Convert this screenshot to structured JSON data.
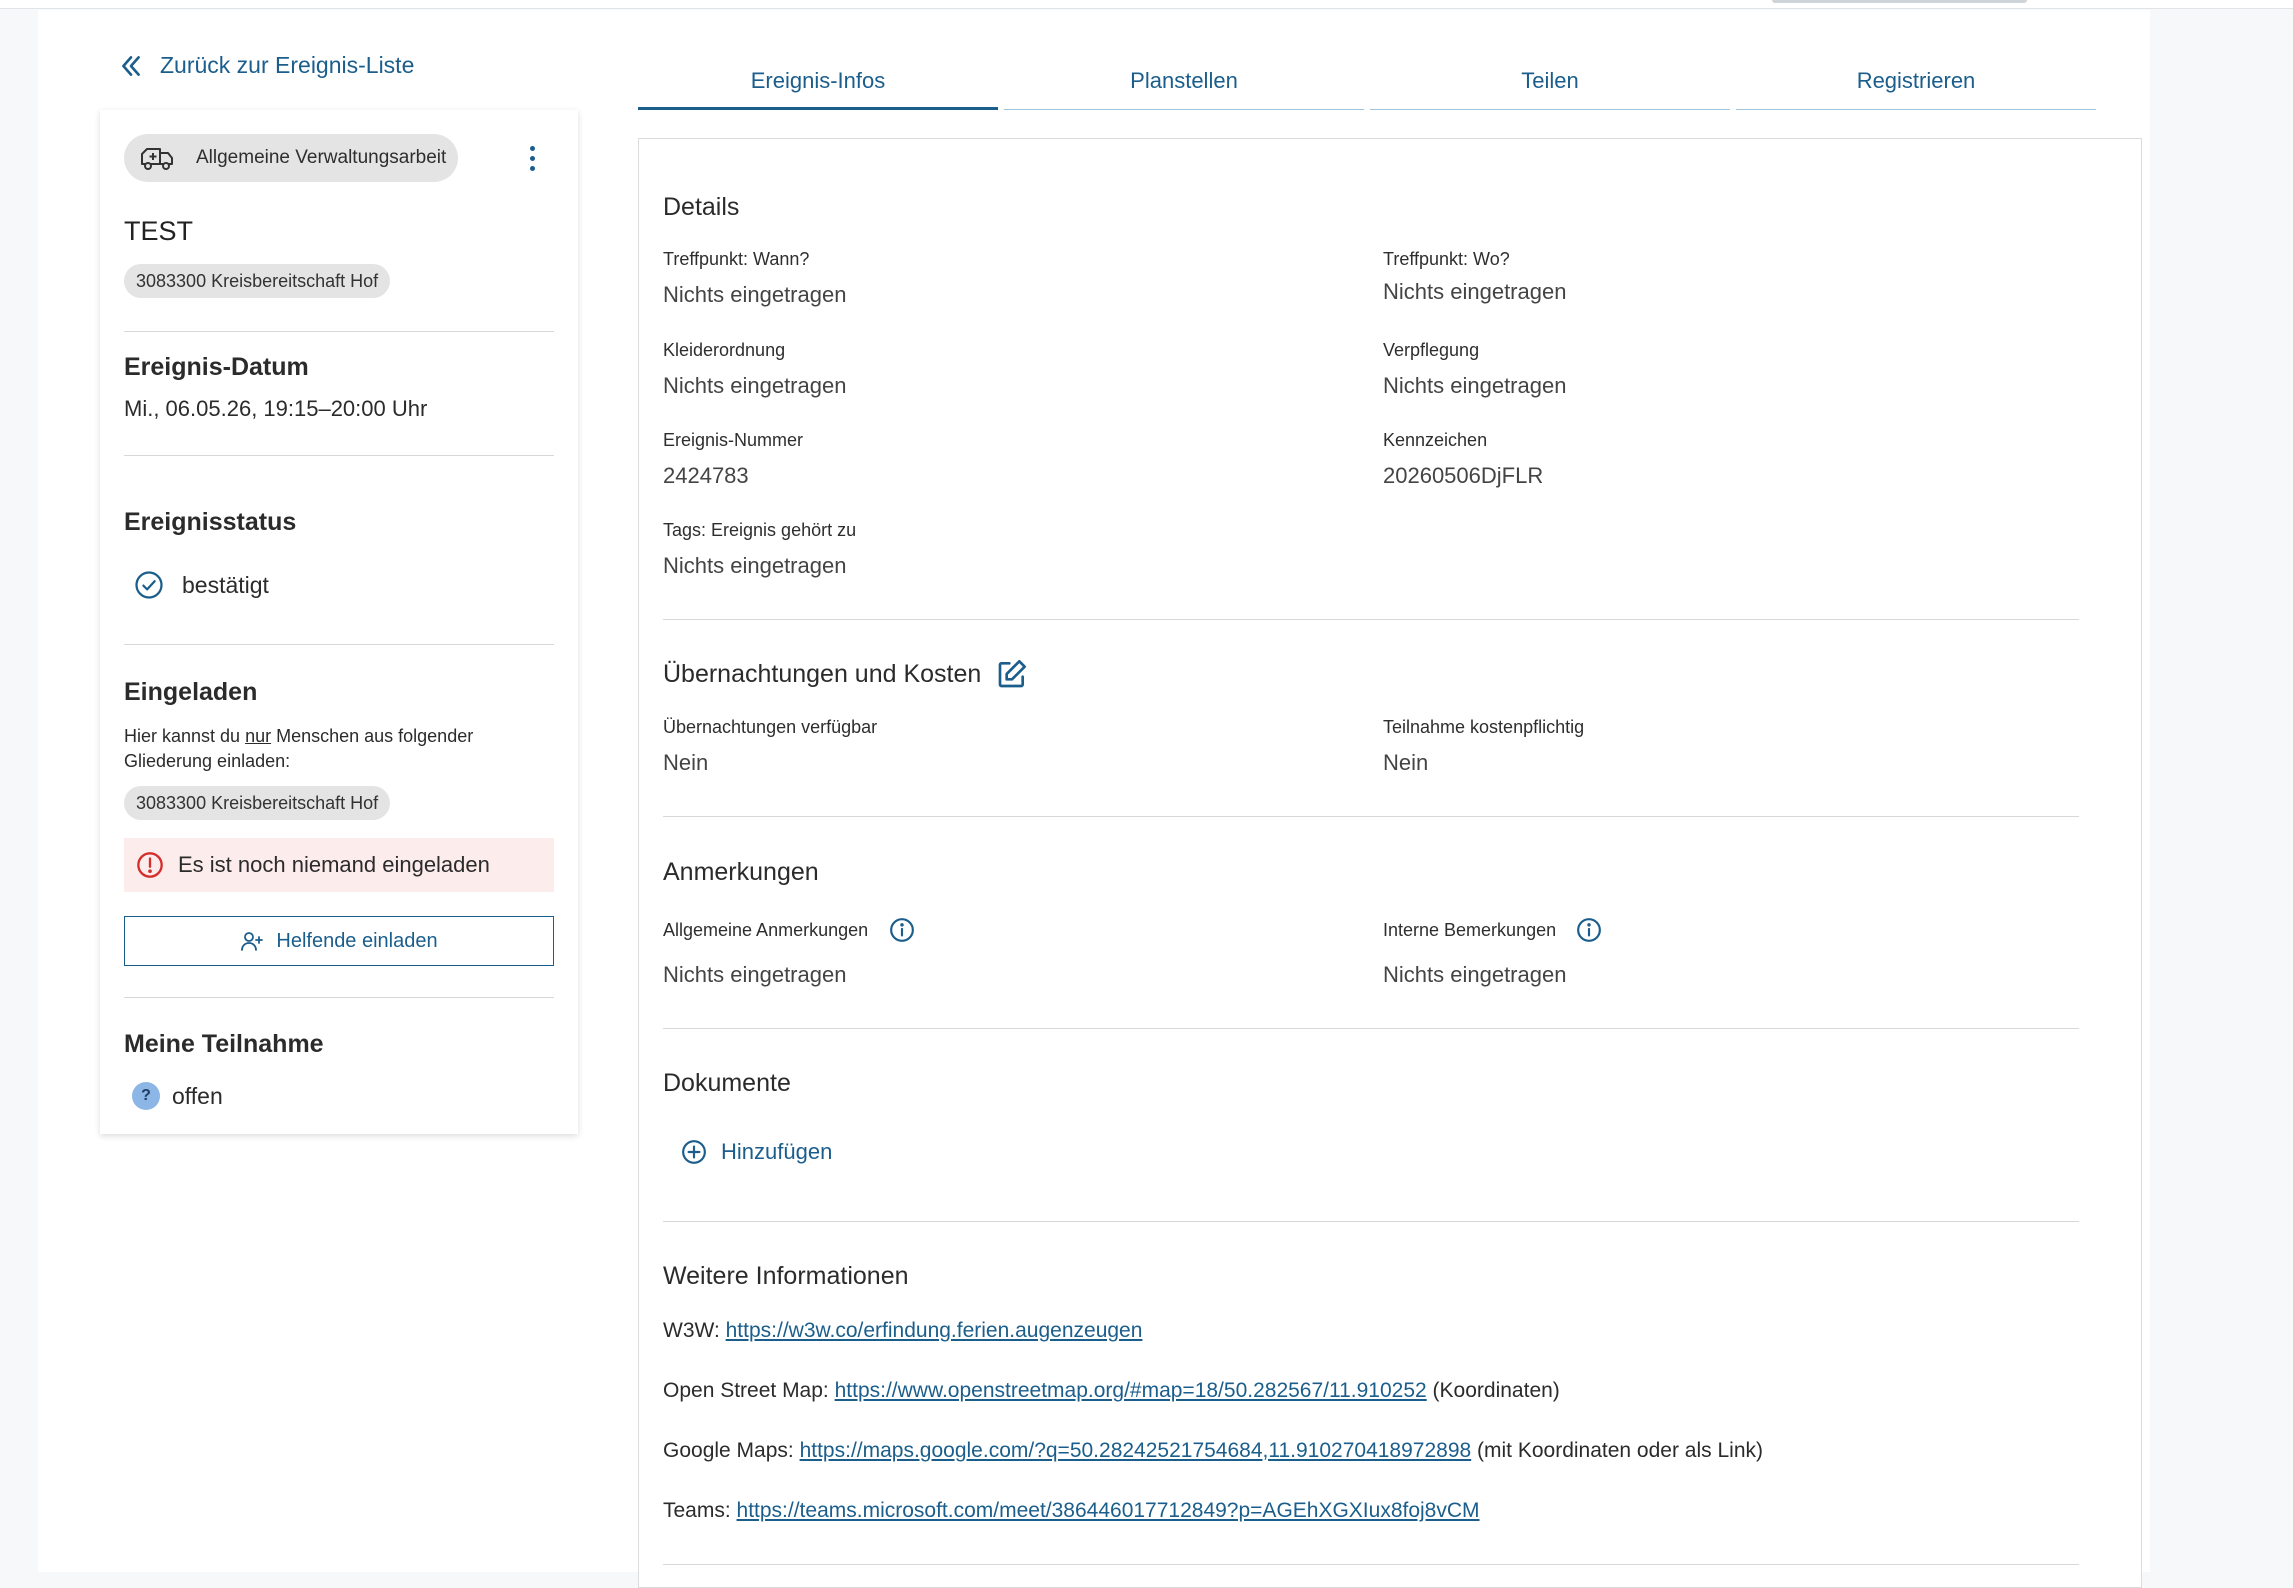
{
  "back_link": {
    "label": "Zurück zur Ereignis-Liste"
  },
  "tabs": [
    {
      "label": "Ereignis-Infos",
      "active": true
    },
    {
      "label": "Planstellen",
      "active": false
    },
    {
      "label": "Teilen",
      "active": false
    },
    {
      "label": "Registrieren",
      "active": false
    }
  ],
  "sidebar": {
    "type_chip": "Allgemeine Verwaltungsarbeit",
    "title": "TEST",
    "org": "3083300 Kreisbereitschaft Hof",
    "date_heading": "Ereignis-Datum",
    "date_value": "Mi., 06.05.26, 19:15–20:00 Uhr",
    "status_heading": "Ereignisstatus",
    "status_value": "bestätigt",
    "invited_heading": "Eingeladen",
    "invite_text_pre": "Hier kannst du ",
    "invite_text_em": "nur",
    "invite_text_post": " Menschen aus folgender Gliederung einladen:",
    "invite_org": "3083300 Kreisbereitschaft Hof",
    "alert_text": "Es ist noch niemand eingeladen",
    "invite_button": "Helfende einladen",
    "participation_heading": "Meine Teilnahme",
    "participation_badge": "?",
    "participation_value": "offen"
  },
  "details": {
    "heading": "Details",
    "fields": [
      {
        "label": "Treffpunkt: Wann?",
        "value": "Nichts eingetragen"
      },
      {
        "label": "Treffpunkt: Wo?",
        "value": "Nichts eingetragen"
      },
      {
        "label": "Kleiderordnung",
        "value": "Nichts eingetragen"
      },
      {
        "label": "Verpflegung",
        "value": "Nichts eingetragen"
      },
      {
        "label": "Ereignis-Nummer",
        "value": "2424783"
      },
      {
        "label": "Kennzeichen",
        "value": "20260506DjFLR"
      },
      {
        "label": "Tags: Ereignis gehört zu",
        "value": "Nichts eingetragen"
      }
    ]
  },
  "stays": {
    "heading": "Übernachtungen und Kosten",
    "fields": [
      {
        "label": "Übernachtungen verfügbar",
        "value": "Nein"
      },
      {
        "label": "Teilnahme kostenpflichtig",
        "value": "Nein"
      }
    ]
  },
  "remarks": {
    "heading": "Anmerkungen",
    "fields": [
      {
        "label": "Allgemeine Anmerkungen",
        "value": "Nichts eingetragen"
      },
      {
        "label": "Interne Bemerkungen",
        "value": "Nichts eingetragen"
      }
    ]
  },
  "documents": {
    "heading": "Dokumente",
    "add_label": "Hinzufügen"
  },
  "more_info": {
    "heading": "Weitere Informationen",
    "lines": [
      {
        "prefix": "W3W: ",
        "link": "https://w3w.co/erfindung.ferien.augenzeugen",
        "suffix": ""
      },
      {
        "prefix": "Open Street Map: ",
        "link": "https://www.openstreetmap.org/#map=18/50.282567/11.910252",
        "suffix": " (Koordinaten)"
      },
      {
        "prefix": "Google Maps: ",
        "link": "https://maps.google.com/?q=50.28242521754684,11.910270418972898",
        "suffix": " (mit Koordinaten oder als Link)"
      },
      {
        "prefix": "Teams: ",
        "link": "https://teams.microsoft.com/meet/386446017712849?p=AGEhXGXIux8foj8vCM",
        "suffix": ""
      }
    ]
  },
  "colors": {
    "accent": "#1b5e8c",
    "alert_bg": "#fdecec",
    "alert_icon": "#d32f2f",
    "chip_bg": "#e4e4e4",
    "badge_bg": "#8cb6e6"
  },
  "icons": {
    "back": "double-chevron-left-icon",
    "type": "ambulance-icon",
    "menu": "kebab-menu-icon",
    "status": "check-circle-icon",
    "alert": "alert-circle-icon",
    "invite": "person-add-icon",
    "edit": "edit-icon",
    "info": "info-icon",
    "add": "plus-circle-icon"
  }
}
